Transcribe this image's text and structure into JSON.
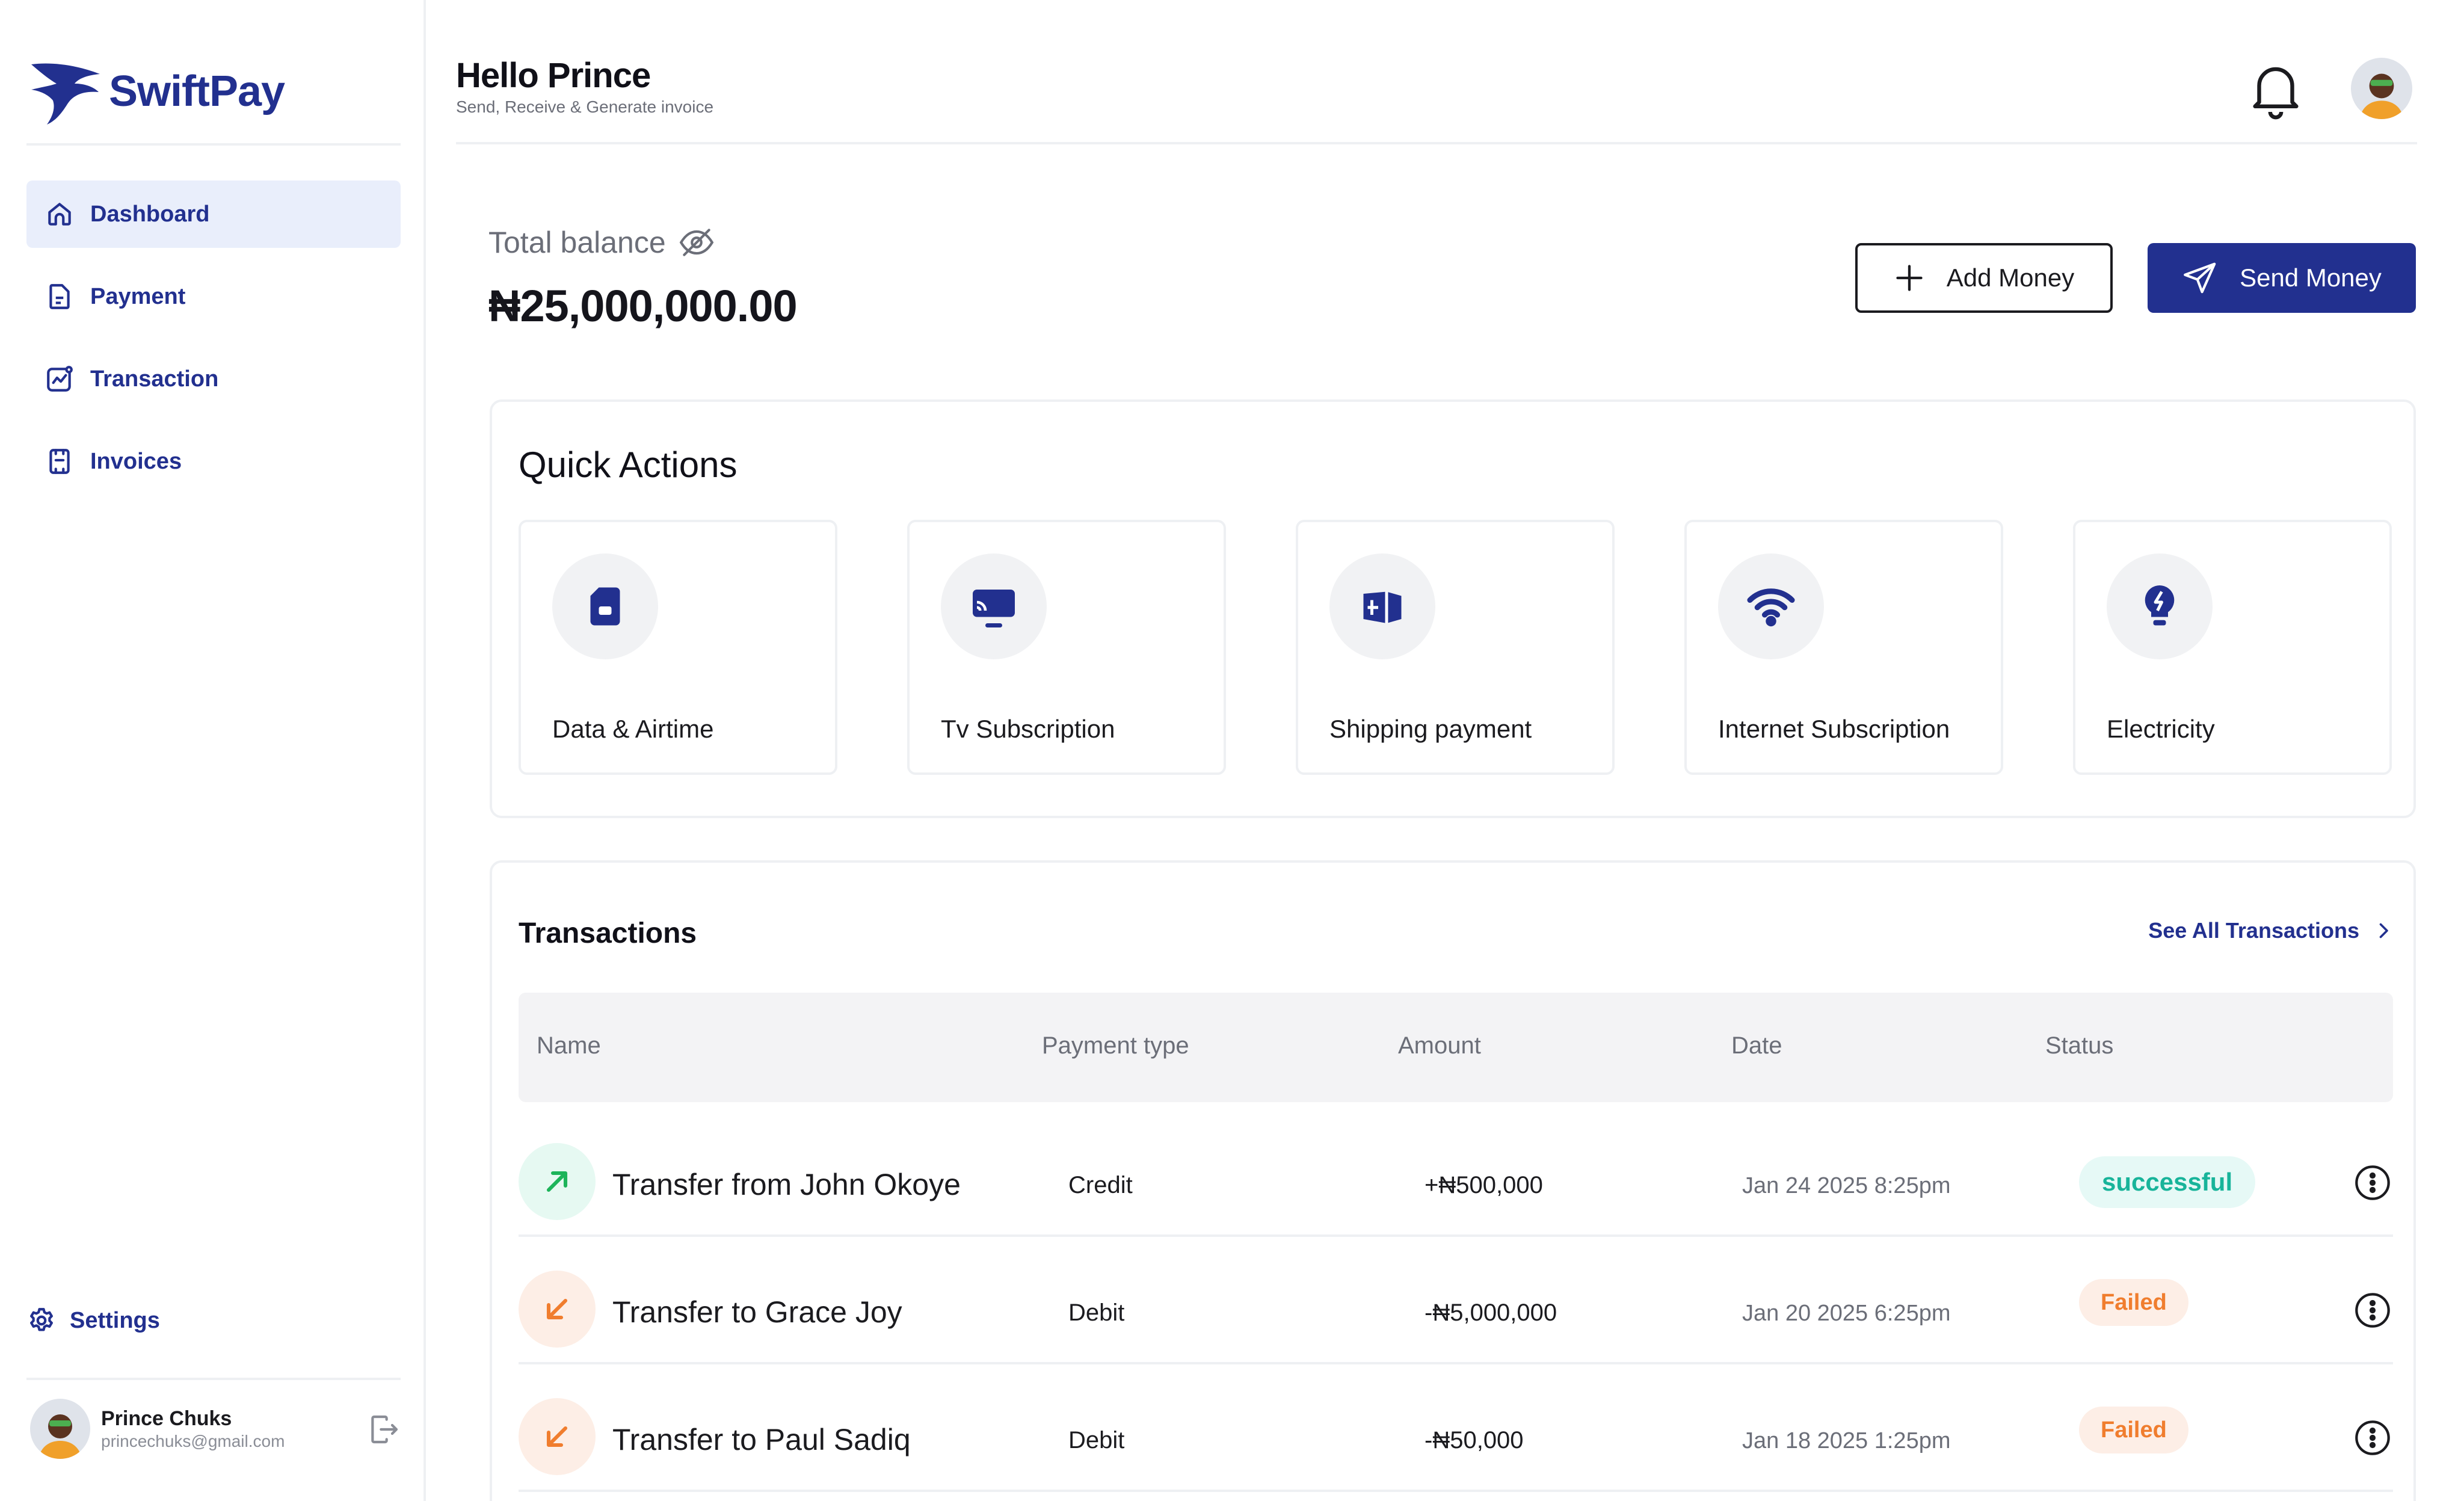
{
  "brand": {
    "name": "SwiftPay",
    "color": "#22308f"
  },
  "sidebar": {
    "items": [
      {
        "label": "Dashboard",
        "icon": "home-icon",
        "active": true
      },
      {
        "label": "Payment",
        "icon": "document-icon",
        "active": false
      },
      {
        "label": "Transaction",
        "icon": "chart-icon",
        "active": false
      },
      {
        "label": "Invoices",
        "icon": "invoice-icon",
        "active": false
      }
    ],
    "settings_label": "Settings",
    "user": {
      "name": "Prince Chuks",
      "email": "princechuks@gmail.com"
    }
  },
  "header": {
    "greeting": "Hello Prince",
    "subtitle": "Send, Receive & Generate invoice"
  },
  "balance": {
    "label": "Total balance",
    "amount": "₦25,000,000.00",
    "add_money_label": "Add Money",
    "send_money_label": "Send Money"
  },
  "quick_actions": {
    "title": "Quick Actions",
    "items": [
      {
        "label": "Data & Airtime",
        "icon": "sim-card-icon"
      },
      {
        "label": "Tv Subscription",
        "icon": "tv-icon"
      },
      {
        "label": "Shipping payment",
        "icon": "package-icon"
      },
      {
        "label": "Internet Subscription",
        "icon": "wifi-icon"
      },
      {
        "label": "Electricity",
        "icon": "bulb-icon"
      }
    ]
  },
  "transactions": {
    "title": "Transactions",
    "see_all_label": "See All Transactions",
    "columns": [
      "Name",
      "Payment  type",
      "Amount",
      "Date",
      "Status"
    ],
    "rows": [
      {
        "name": "Transfer from John Okoye",
        "type": "Credit",
        "amount": "+₦500,000",
        "date": "Jan 24 2025  8:25pm",
        "status": "successful",
        "direction": "incoming"
      },
      {
        "name": "Transfer to Grace Joy",
        "type": "Debit",
        "amount": "-₦5,000,000",
        "date": "Jan 20 2025  6:25pm",
        "status": "Failed",
        "direction": "outgoing"
      },
      {
        "name": "Transfer to Paul Sadiq",
        "type": "Debit",
        "amount": "-₦50,000",
        "date": "Jan 18 2025  1:25pm",
        "status": "Failed",
        "direction": "outgoing"
      }
    ]
  },
  "colors": {
    "accent": "#22308f",
    "success": "#18b49a",
    "failed": "#f07d2e",
    "active_nav_bg": "#e9eefb"
  }
}
